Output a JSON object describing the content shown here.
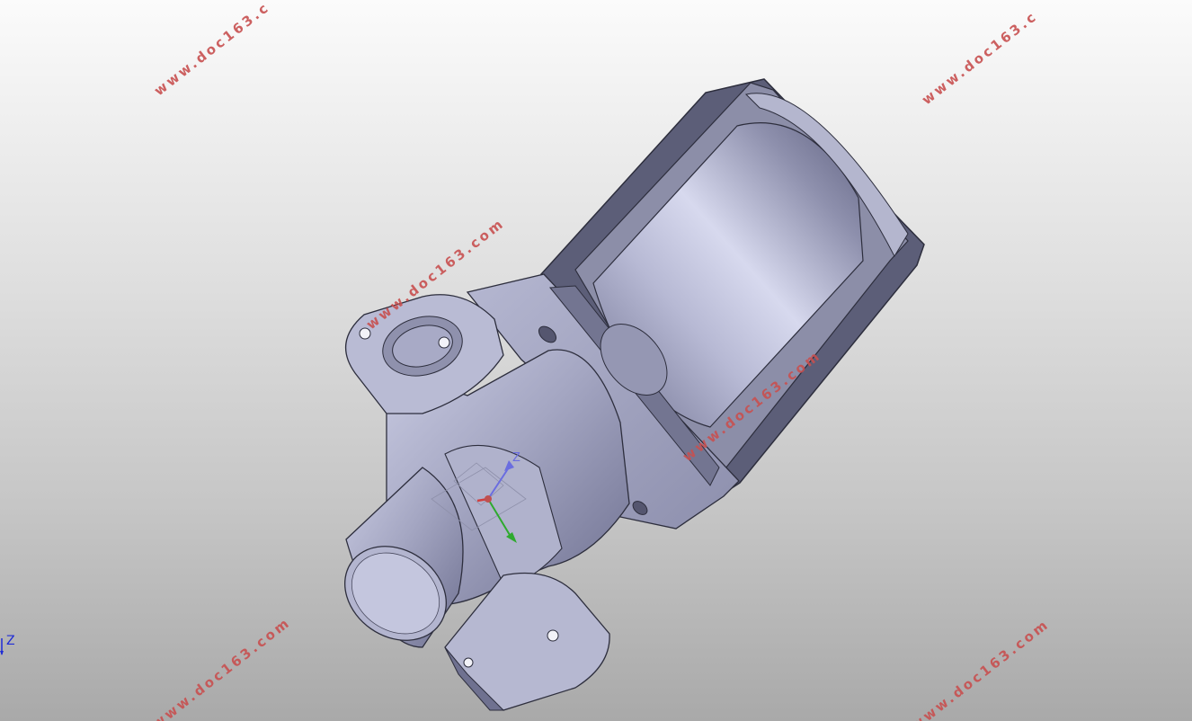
{
  "viewport": {
    "corner_axis_label": "Z",
    "model_axis_label": "Z"
  },
  "watermarks": [
    "www.doc163.c",
    "www.doc163.c",
    "www.doc163.com",
    "www.doc163.com",
    "www.doc163.com",
    "www.doc163.com"
  ],
  "colors": {
    "background_top": "#fbfbfb",
    "background_bottom": "#a9a9a9",
    "part_body": "#a8a9c4",
    "part_shadow": "#6c6d8a",
    "watermark": "#c85050",
    "axis_z": "#1f2bd6",
    "axis_x": "#d04040",
    "axis_y": "#2eaa2e"
  }
}
